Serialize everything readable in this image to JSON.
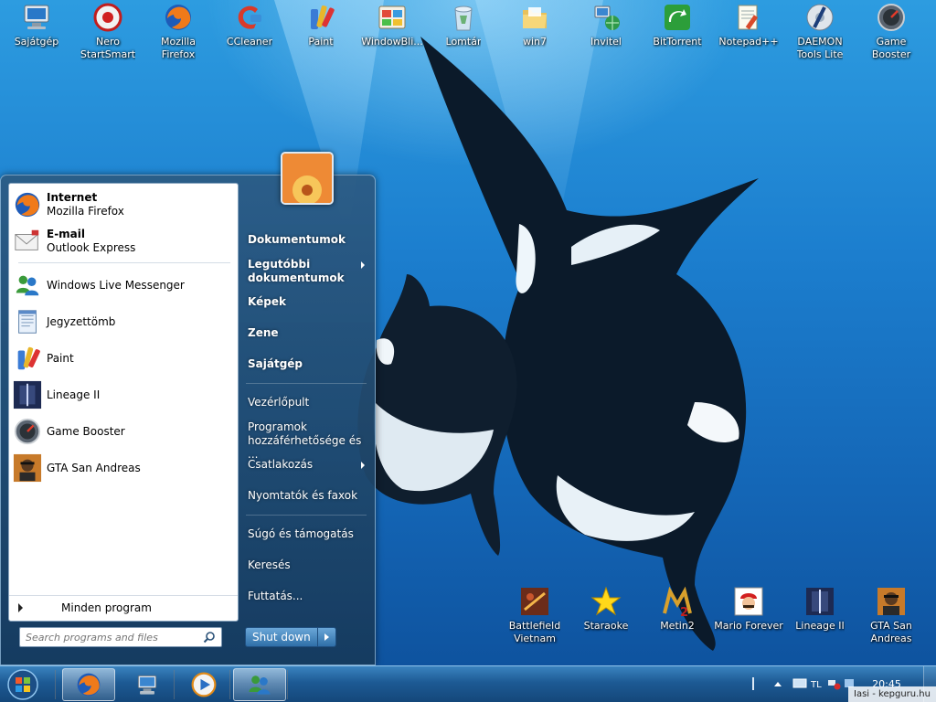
{
  "desktop": {
    "top_icons": [
      {
        "label": "Sajátgép",
        "icon": "computer-icon"
      },
      {
        "label": "Nero\nStartSmart",
        "icon": "nero-icon"
      },
      {
        "label": "Mozilla\nFirefox",
        "icon": "firefox-icon"
      },
      {
        "label": "CCleaner",
        "icon": "ccleaner-icon"
      },
      {
        "label": "Paint",
        "icon": "paint-icon"
      },
      {
        "label": "WindowBli...",
        "icon": "windowblinds-icon"
      },
      {
        "label": "Lomtár",
        "icon": "recycle-bin-icon"
      },
      {
        "label": "win7",
        "icon": "folder-icon"
      },
      {
        "label": "Invitel",
        "icon": "network-icon"
      },
      {
        "label": "BitTorrent",
        "icon": "bittorrent-icon"
      },
      {
        "label": "Notepad++",
        "icon": "notepad-plus-icon"
      },
      {
        "label": "DAEMON\nTools Lite",
        "icon": "daemon-tools-icon"
      },
      {
        "label": "Game Booster",
        "icon": "game-booster-icon"
      }
    ],
    "bottom_icons": [
      {
        "label": "Battlefield\nVietnam",
        "icon": "battlefield-icon"
      },
      {
        "label": "Staraoke",
        "icon": "star-icon"
      },
      {
        "label": "Metin2",
        "icon": "metin2-icon"
      },
      {
        "label": "Mario Forever",
        "icon": "mario-icon"
      },
      {
        "label": "Lineage II",
        "icon": "lineage-icon"
      },
      {
        "label": "GTA San\nAndreas",
        "icon": "gta-icon"
      }
    ]
  },
  "start_menu": {
    "pinned": [
      {
        "title": "Internet",
        "subtitle": "Mozilla Firefox"
      },
      {
        "title": "E-mail",
        "subtitle": "Outlook Express"
      }
    ],
    "recent": [
      {
        "label": "Windows Live Messenger",
        "icon": "messenger-icon"
      },
      {
        "label": "Jegyzettömb",
        "icon": "notepad-icon"
      },
      {
        "label": "Paint",
        "icon": "paint-icon"
      },
      {
        "label": "Lineage II",
        "icon": "lineage-icon"
      },
      {
        "label": "Game Booster",
        "icon": "game-booster-icon"
      },
      {
        "label": "GTA San Andreas",
        "icon": "gta-icon"
      }
    ],
    "all_programs": "Minden program",
    "search_placeholder": "Search programs and files",
    "right_items": [
      {
        "label": "Dokumentumok"
      },
      {
        "label": "Legutóbbi dokumentumok"
      },
      {
        "label": "Képek"
      },
      {
        "label": "Zene"
      },
      {
        "label": "Sajátgép"
      },
      {
        "label": "Vezérlőpult"
      },
      {
        "label": "Programok hozzáférhetősége és ..."
      },
      {
        "label": "Csatlakozás"
      },
      {
        "label": "Nyomtatók és faxok"
      },
      {
        "label": "Súgó és támogatás"
      },
      {
        "label": "Keresés"
      },
      {
        "label": "Futtatás..."
      }
    ],
    "shutdown_label": "Shut down"
  },
  "taskbar": {
    "pinned": [
      "firefox-icon",
      "network-computer-icon",
      "media-player-icon",
      "messenger-icon"
    ],
    "clock": "20:45",
    "watermark": "Iasi - kepguru.hu"
  },
  "colors": {
    "taskbar": "#1d5a94",
    "start_menu_right": "#2c5a82"
  }
}
